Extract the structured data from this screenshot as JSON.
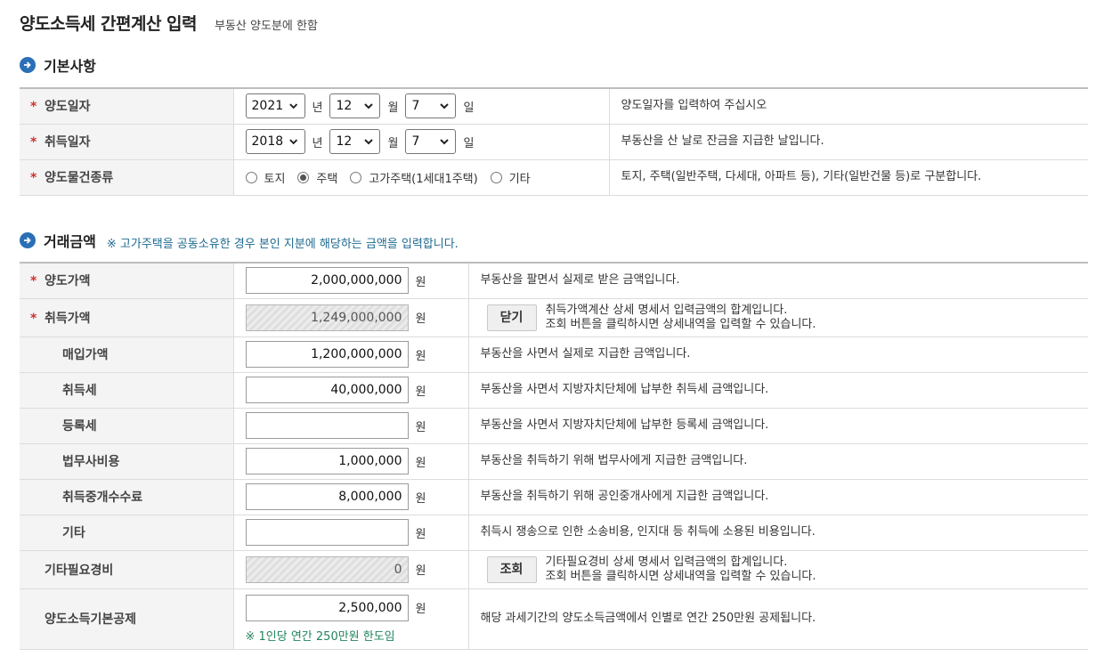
{
  "page": {
    "title": "양도소득세 간편계산 입력",
    "subtitle": "부동산 양도분에 한함"
  },
  "sections": {
    "basic": {
      "title": "기본사항"
    },
    "amount": {
      "title": "거래금액",
      "note": "※ 고가주택을 공동소유한 경우 본인 지분에 해당하는 금액을 입력합니다."
    }
  },
  "basic": {
    "transfer_date": {
      "label": "양도일자",
      "year": "2021",
      "year_unit": "년",
      "month": "12",
      "month_unit": "월",
      "day": "7",
      "day_unit": "일",
      "desc": "양도일자를 입력하여 주십시오"
    },
    "acquire_date": {
      "label": "취득일자",
      "year": "2018",
      "year_unit": "년",
      "month": "12",
      "month_unit": "월",
      "day": "7",
      "day_unit": "일",
      "desc": "부동산을 산 날로 잔금을 지급한 날입니다."
    },
    "property_type": {
      "label": "양도물건종류",
      "options": [
        "토지",
        "주택",
        "고가주택(1세대1주택)",
        "기타"
      ],
      "selected": "주택",
      "desc": "토지, 주택(일반주택, 다세대, 아파트 등), 기타(일반건물 등)로 구분합니다."
    }
  },
  "amount": {
    "currency_unit": "원",
    "transfer_price": {
      "label": "양도가액",
      "value": "2,000,000,000",
      "desc": "부동산을 팔면서 실제로 받은 금액입니다."
    },
    "acquire_price": {
      "label": "취득가액",
      "value": "1,249,000,000",
      "button": "닫기",
      "desc1": "취득가액계산 상세 명세서 입력금액의 합계입니다.",
      "desc2": "조회 버튼을 클릭하시면 상세내역을 입력할 수 있습니다."
    },
    "purchase_price": {
      "label": "매입가액",
      "value": "1,200,000,000",
      "desc": "부동산을 사면서 실제로 지급한 금액입니다."
    },
    "acquisition_tax": {
      "label": "취득세",
      "value": "40,000,000",
      "desc": "부동산을 사면서 지방자치단체에 납부한 취득세 금액입니다."
    },
    "registration_tax": {
      "label": "등록세",
      "value": "",
      "desc": "부동산을 사면서 지방자치단체에 납부한 등록세 금액입니다."
    },
    "legal_fee": {
      "label": "법무사비용",
      "value": "1,000,000",
      "desc": "부동산을 취득하기 위해 법무사에게 지급한 금액입니다."
    },
    "brokerage_fee": {
      "label": "취득중개수수료",
      "value": "8,000,000",
      "desc": "부동산을 취득하기 위해 공인중개사에게 지급한 금액입니다."
    },
    "other": {
      "label": "기타",
      "value": "",
      "desc": "취득시 쟁송으로 인한 소송비용, 인지대 등 취득에 소용된 비용입니다."
    },
    "other_expenses": {
      "label": "기타필요경비",
      "value": "0",
      "button": "조회",
      "desc1": "기타필요경비 상세 명세서 입력금액의 합계입니다.",
      "desc2": "조회 버튼을 클릭하시면 상세내역을 입력할 수 있습니다."
    },
    "basic_deduction": {
      "label": "양도소득기본공제",
      "value": "2,500,000",
      "note": "※ 1인당 연간 250만원 한도임",
      "desc": "해당 과세기간의 양도소득금액에서 인별로 연간 250만원 공제됩니다."
    }
  }
}
